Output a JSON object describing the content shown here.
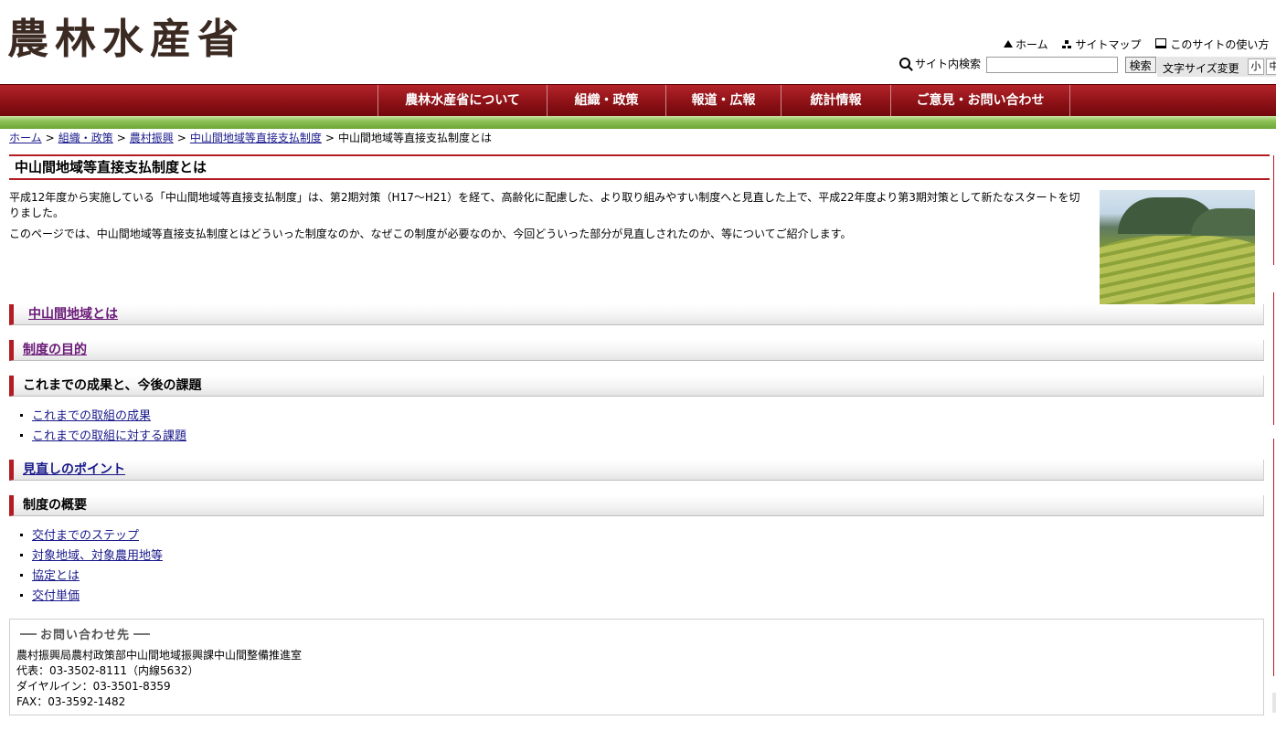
{
  "header": {
    "logo": "農林水産省",
    "utility": {
      "home": "ホーム",
      "sitemap": "サイトマップ",
      "howto": "このサイトの使い方"
    },
    "search": {
      "label": "サイト内検索",
      "placeholder": "",
      "button": "検索"
    },
    "font_size": {
      "label": "文字サイズ変更",
      "small": "小",
      "medium": "中"
    }
  },
  "nav": {
    "items": [
      {
        "label": "農林水産省について"
      },
      {
        "label": "組織・政策"
      },
      {
        "label": "報道・広報"
      },
      {
        "label": "統計情報"
      },
      {
        "label": "ご意見・お問い合わせ"
      }
    ]
  },
  "breadcrumb": {
    "items": [
      {
        "label": "ホーム"
      },
      {
        "label": "組織・政策"
      },
      {
        "label": "農村振興"
      },
      {
        "label": "中山間地域等直接支払制度"
      }
    ],
    "current": "中山間地域等直接支払制度とは",
    "separator": ">"
  },
  "page": {
    "title": "中山間地域等直接支払制度とは",
    "intro1": "平成12年度から実施している「中山間地域等直接支払制度」は、第2期対策（H17～H21）を経て、高齢化に配慮した、より取り組みやすい制度へと見直した上で、平成22年度より第3期対策として新たなスタートを切りました。",
    "intro2": "このページでは、中山間地域等直接支払制度とはどういった制度なのか、なぜこの制度が必要なのか、今回どういった部分が見直しされたのか、等についてご紹介します。"
  },
  "sections": {
    "what": "中山間地域とは",
    "purpose": "制度の目的",
    "results": {
      "title": "これまでの成果と、今後の課題",
      "links": [
        "これまでの取組の成果",
        "これまでの取組に対する課題"
      ]
    },
    "review": "見直しのポイント",
    "overview": {
      "title": "制度の概要",
      "links": [
        "交付までのステップ",
        "対象地域、対象農用地等",
        "協定とは",
        "交付単価"
      ]
    }
  },
  "contact": {
    "title": "お問い合わせ先",
    "dept": "農村振興局農村政策部中山間地域振興課中山間整備推進室",
    "tel": "代表：03-3502-8111（内線5632）",
    "dial": "ダイヤルイン：03-3501-8359",
    "fax": "FAX：03-3592-1482"
  },
  "colors": {
    "brand_red": "#8c1116",
    "accent_green": "#8dc155",
    "link": "#1a1a8c",
    "visited_link": "#6a1a78"
  }
}
